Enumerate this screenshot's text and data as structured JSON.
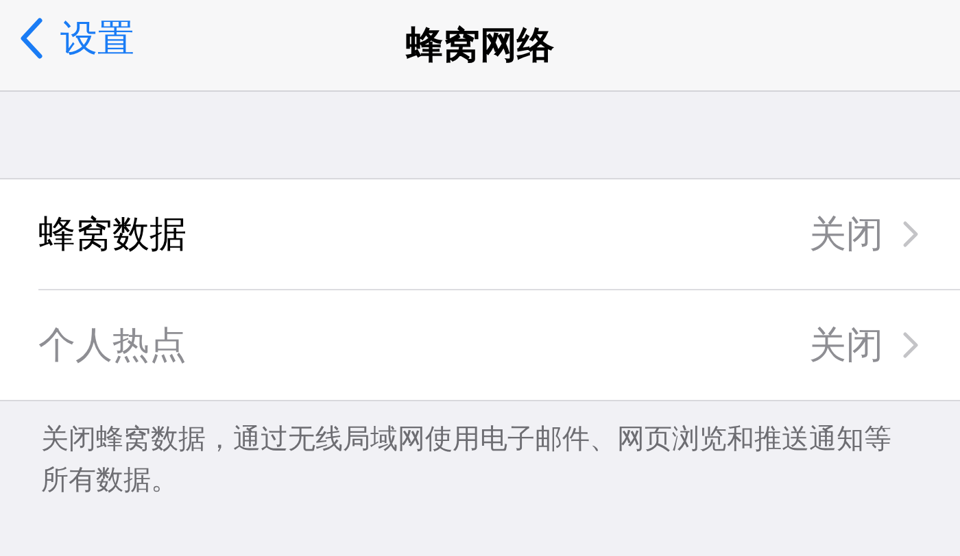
{
  "nav": {
    "back_label": "设置",
    "title": "蜂窝网络"
  },
  "rows": [
    {
      "label": "蜂窝数据",
      "value": "关闭",
      "disabled": false
    },
    {
      "label": "个人热点",
      "value": "关闭",
      "disabled": true
    }
  ],
  "footer": "关闭蜂窝数据，通过无线局域网使用电子邮件、网页浏览和推送通知等所有数据。"
}
